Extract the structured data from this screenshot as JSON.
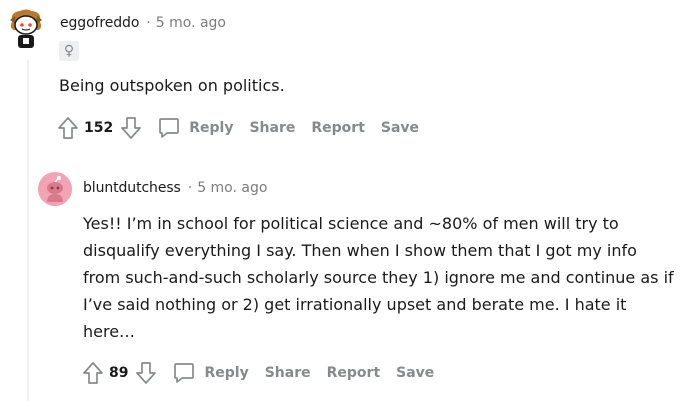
{
  "comments": [
    {
      "username": "eggofreddo",
      "separator": "·",
      "timestamp": "5 mo. ago",
      "flair_icon": "female-symbol-icon",
      "flair_text": "♀",
      "body": "Being outspoken on politics.",
      "score": "152",
      "actions": {
        "reply": "Reply",
        "share": "Share",
        "report": "Report",
        "save": "Save"
      }
    },
    {
      "username": "bluntdutchess",
      "separator": "·",
      "timestamp": "5 mo. ago",
      "body": "Yes!! I’m in school for political science and ~80% of men will try to disqualify everything I say. Then when I show them that I got my info from such-and-such scholarly source they 1) ignore me and continue as if I’ve said nothing or 2) get irrationally upset and berate me. I hate it here…",
      "score": "89",
      "actions": {
        "reply": "Reply",
        "share": "Share",
        "report": "Report",
        "save": "Save"
      }
    }
  ],
  "colors": {
    "text": "#1a1a1b",
    "meta": "#7c7c7c",
    "action": "#878a8c",
    "thread_line": "#edeff1",
    "avatar2_bg": "#f3a4b4"
  }
}
